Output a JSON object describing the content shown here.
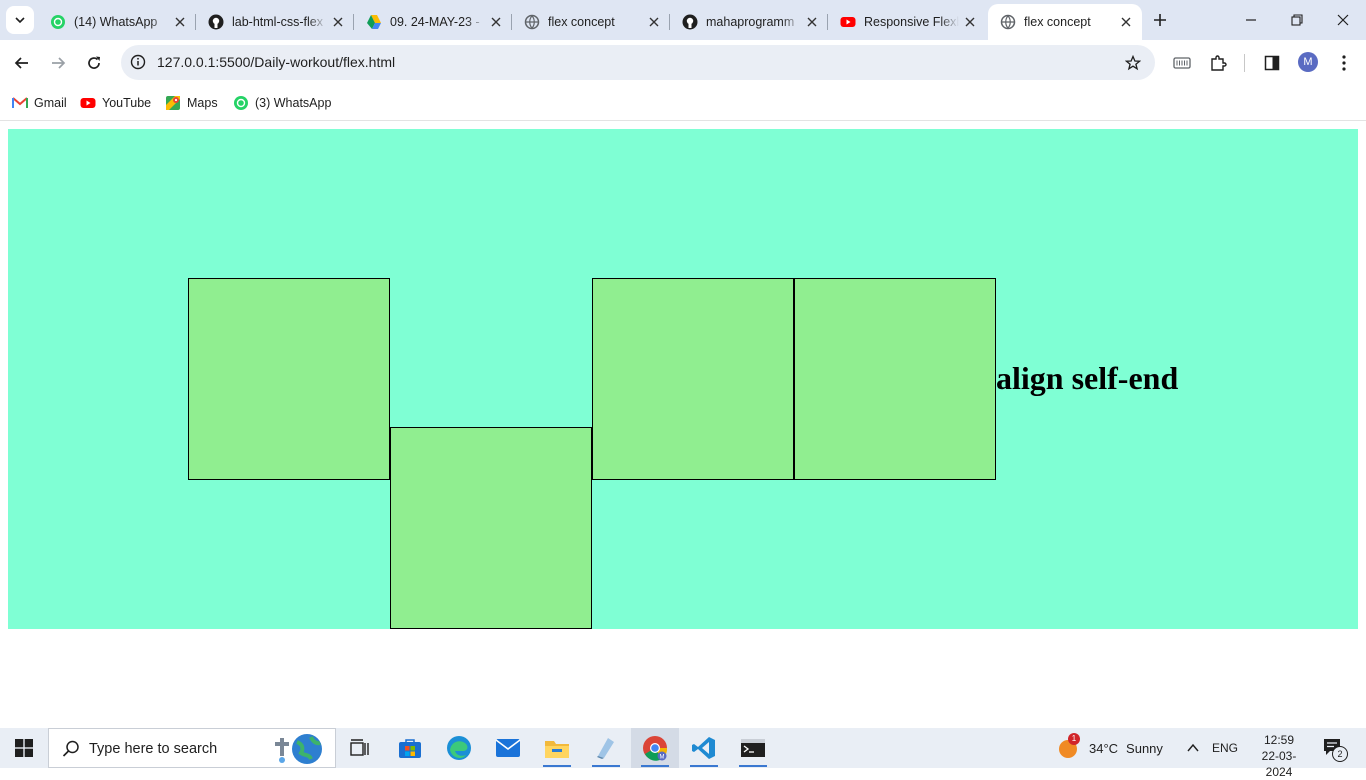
{
  "browser": {
    "tabs": [
      {
        "title": "(14) WhatsApp",
        "icon": "whatsapp-icon",
        "active": false
      },
      {
        "title": "lab-html-css-flex",
        "icon": "github-icon",
        "active": false
      },
      {
        "title": "09. 24-MAY-23 -",
        "icon": "google-drive-icon",
        "active": false
      },
      {
        "title": "flex concept",
        "icon": "globe-icon",
        "active": false
      },
      {
        "title": "mahaprogramm",
        "icon": "github-icon",
        "active": false
      },
      {
        "title": "Responsive Flexb",
        "icon": "youtube-icon",
        "active": false
      },
      {
        "title": "flex concept",
        "icon": "globe-icon",
        "active": true
      }
    ],
    "address": {
      "url": "127.0.0.1:5500/Daily-workout/flex.html"
    },
    "profile": {
      "initial": "M"
    },
    "bookmarks": [
      {
        "label": "Gmail",
        "icon": "gmail-icon"
      },
      {
        "label": "YouTube",
        "icon": "youtube-icon"
      },
      {
        "label": "Maps",
        "icon": "maps-icon"
      },
      {
        "label": "(3) WhatsApp",
        "icon": "whatsapp-icon"
      }
    ]
  },
  "page": {
    "heading": "align self-end",
    "colors": {
      "container": "#7fffd4",
      "box": "#90ee90",
      "box_border": "#000000"
    },
    "boxes": 4
  },
  "taskbar": {
    "search_placeholder": "Type here to search",
    "weather": {
      "temp": "34°C",
      "condition": "Sunny",
      "alert_count": "1"
    },
    "language": "ENG",
    "time": "12:59",
    "date": "22-03-2024",
    "notifications": "2"
  }
}
